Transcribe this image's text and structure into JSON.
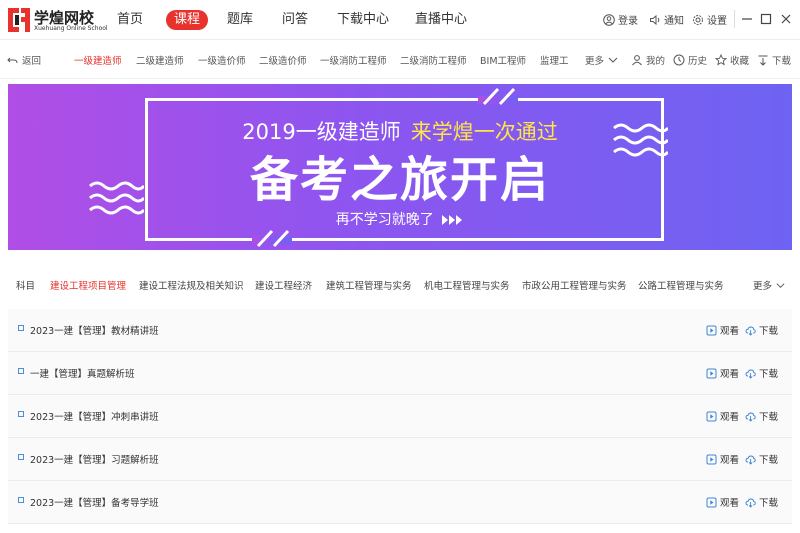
{
  "app": {
    "logo_cn": "学煌网校",
    "logo_en": "Xuehuang Online School"
  },
  "nav": [
    {
      "label": "首页",
      "active": false
    },
    {
      "label": "课程",
      "active": true
    },
    {
      "label": "题库",
      "active": false
    },
    {
      "label": "问答",
      "active": false
    },
    {
      "label": "下载中心",
      "active": false
    },
    {
      "label": "直播中心",
      "active": false
    }
  ],
  "top_right": {
    "login": "登录",
    "notice": "通知",
    "settings": "设置"
  },
  "subbar": {
    "back": "返回",
    "categories": [
      "一级建造师",
      "二级建造师",
      "一级造价师",
      "二级造价师",
      "一级消防工程师",
      "二级消防工程师",
      "BIM工程师",
      "监理工"
    ],
    "active_category": "一级建造师",
    "more": "更多",
    "mine": "我的",
    "history": "历史",
    "favorite": "收藏",
    "download": "下载"
  },
  "banner": {
    "line1": "2019一级建造师",
    "line1_highlight": "来学煌一次通过",
    "line2": "备考之旅开启",
    "line3": "再不学习就晚了"
  },
  "subjects": {
    "label": "科目",
    "items": [
      "建设工程项目管理",
      "建设工程法规及相关知识",
      "建设工程经济",
      "建筑工程管理与实务",
      "机电工程管理与实务",
      "市政公用工程管理与实务",
      "公路工程管理与实务"
    ],
    "active": "建设工程项目管理",
    "more": "更多"
  },
  "courses": [
    {
      "title": "2023一建【管理】教材精讲班",
      "watch": "观看",
      "download": "下载"
    },
    {
      "title": "一建【管理】真题解析班",
      "watch": "观看",
      "download": "下载"
    },
    {
      "title": "2023一建【管理】冲刺串讲班",
      "watch": "观看",
      "download": "下载"
    },
    {
      "title": "2023一建【管理】习题解析班",
      "watch": "观看",
      "download": "下载"
    },
    {
      "title": "2023一建【管理】备考导学班",
      "watch": "观看",
      "download": "下载"
    }
  ],
  "colors": {
    "accent": "#e8322d",
    "banner_start": "#b04ee6",
    "banner_end": "#6e63f2",
    "highlight": "#ffe54a"
  }
}
